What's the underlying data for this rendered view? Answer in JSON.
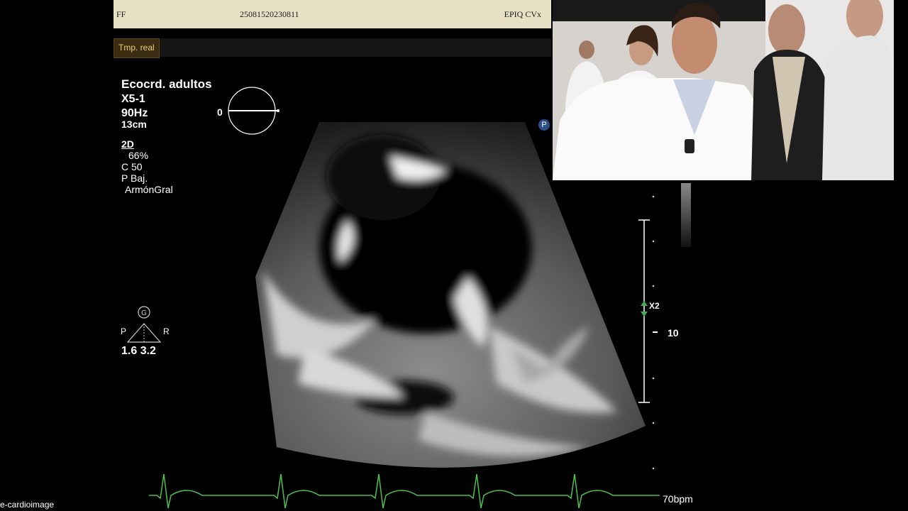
{
  "header": {
    "left_label": "FF",
    "study_id": "25081520230811",
    "device": "EPIQ CVx"
  },
  "tabs": {
    "realtime": "Tmp. real"
  },
  "params": {
    "preset": "Ecocrd. adultos",
    "probe": "X5-1",
    "frame_rate": "90Hz",
    "depth": "13cm",
    "mode": "2D",
    "gain": "66%",
    "compression": "C 50",
    "power": "P Baj.",
    "harmonic": "ArmónGral"
  },
  "angle_indicator": {
    "value": "0"
  },
  "orientation": {
    "g_label": "G",
    "p_label": "P",
    "r_label": "R",
    "values": "1.6  3.2"
  },
  "depth_scale": {
    "zoom": "X2",
    "depth_mark": "10"
  },
  "ecg": {
    "heart_rate": "70bpm",
    "color": "#4ec04e"
  },
  "marker": {
    "label": "P"
  },
  "watermark": "e-cardioimage"
}
